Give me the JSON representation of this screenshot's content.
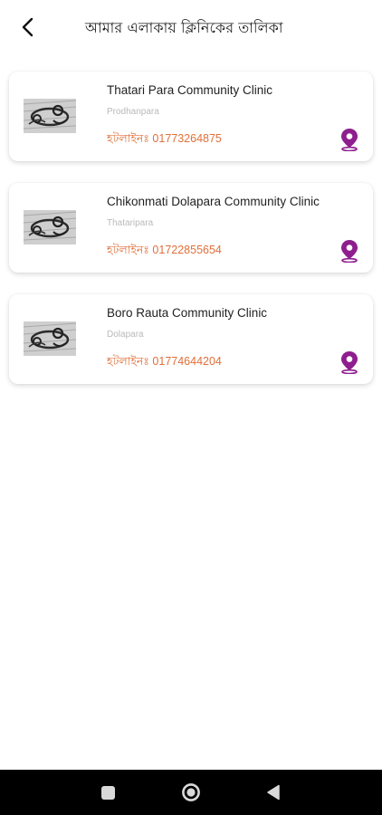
{
  "header": {
    "title": "আমার এলাকায় ক্লিনিকের তালিকা",
    "back_icon": "chevron-left-icon"
  },
  "clinics": [
    {
      "name": "Thatari Para Community Clinic",
      "area": "Prodhanpara",
      "hotline": "হটলাইনঃ 01773264875"
    },
    {
      "name": "Chikonmati Dolapara Community Clinic",
      "area": "Thataripara",
      "hotline": "হটলাইনঃ 01722855654"
    },
    {
      "name": "Boro Rauta Community Clinic",
      "area": "Dolapara",
      "hotline": "হটলাইনঃ 01774644204"
    }
  ],
  "card_icons": {
    "thumbnail": "clinic-photo",
    "map": "map-pin-icon"
  },
  "nav": {
    "recents": "square-icon",
    "home": "circle-icon",
    "back": "triangle-back-icon"
  },
  "colors": {
    "hotline": "#e0703a",
    "pin": "#8e1e8e",
    "nav_bar": "#000000"
  }
}
